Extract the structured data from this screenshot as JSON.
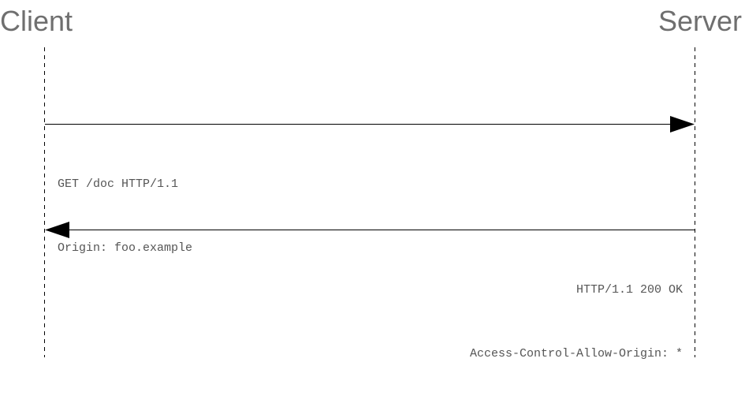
{
  "actors": {
    "client": "Client",
    "server": "Server"
  },
  "messages": [
    {
      "direction": "client-to-server",
      "lines": [
        "GET /doc HTTP/1.1",
        "Origin: foo.example"
      ]
    },
    {
      "direction": "server-to-client",
      "lines": [
        "HTTP/1.1 200 OK",
        "Access-Control-Allow-Origin: *"
      ]
    }
  ],
  "colors": {
    "label": "#6f6f6f",
    "line": "#000000",
    "text": "#555555"
  }
}
